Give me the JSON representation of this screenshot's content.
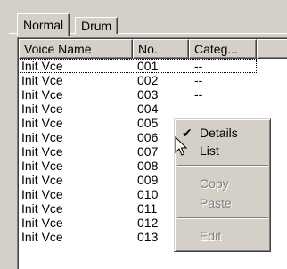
{
  "tabs": [
    {
      "label": "Normal",
      "active": true
    },
    {
      "label": "Drum",
      "active": false
    }
  ],
  "listview": {
    "columns": [
      "Voice Name",
      "No.",
      "Categ..."
    ],
    "rows": [
      {
        "name": "Init Vce",
        "no": "001",
        "category": "--"
      },
      {
        "name": "Init Vce",
        "no": "002",
        "category": "--"
      },
      {
        "name": "Init Vce",
        "no": "003",
        "category": "--"
      },
      {
        "name": "Init Vce",
        "no": "004",
        "category": ""
      },
      {
        "name": "Init Vce",
        "no": "005",
        "category": ""
      },
      {
        "name": "Init Vce",
        "no": "006",
        "category": ""
      },
      {
        "name": "Init Vce",
        "no": "007",
        "category": ""
      },
      {
        "name": "Init Vce",
        "no": "008",
        "category": ""
      },
      {
        "name": "Init Vce",
        "no": "009",
        "category": ""
      },
      {
        "name": "Init Vce",
        "no": "010",
        "category": ""
      },
      {
        "name": "Init Vce",
        "no": "011",
        "category": ""
      },
      {
        "name": "Init Vce",
        "no": "012",
        "category": "--"
      },
      {
        "name": "Init Vce",
        "no": "013",
        "category": ""
      }
    ]
  },
  "context_menu": {
    "items": [
      {
        "label": "Details",
        "checked": true,
        "enabled": true
      },
      {
        "label": "List",
        "checked": false,
        "enabled": true
      },
      {
        "label": "Copy",
        "checked": false,
        "enabled": false
      },
      {
        "label": "Paste",
        "checked": false,
        "enabled": false
      },
      {
        "label": "Edit",
        "checked": false,
        "enabled": false
      }
    ],
    "check_glyph": "✔"
  },
  "cursor_icon": "arrow-pointer-icon",
  "colors": {
    "face": "#d4d0c8",
    "window": "#ffffff",
    "shadow": "#808080",
    "dark_shadow": "#404040",
    "disabled_text": "#808080"
  }
}
